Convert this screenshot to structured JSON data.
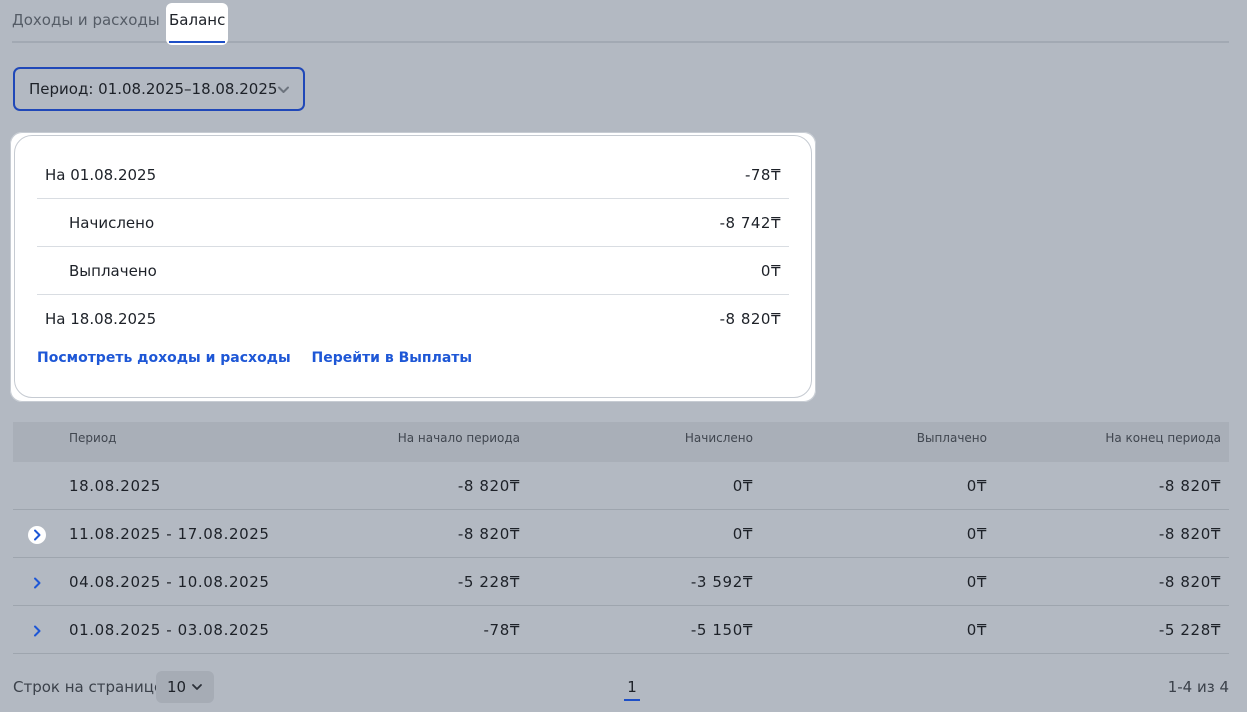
{
  "tabs": [
    {
      "label": "Доходы и расходы"
    },
    {
      "label": "Баланс"
    }
  ],
  "period_select": {
    "label": "Период: 01.08.2025–18.08.2025"
  },
  "balance_card": {
    "rows": [
      {
        "label": "На 01.08.2025",
        "value": "-78₸"
      },
      {
        "label": "Начислено",
        "value": "-8 742₸"
      },
      {
        "label": "Выплачено",
        "value": "0₸"
      },
      {
        "label": "На 18.08.2025",
        "value": "-8 820₸"
      }
    ],
    "links": {
      "view": "Посмотреть доходы и расходы",
      "payouts": "Перейти в Выплаты"
    }
  },
  "table": {
    "headers": {
      "period": "Период",
      "start": "На начало периода",
      "accrued": "Начислено",
      "paid": "Выплачено",
      "end": "На конец периода"
    },
    "rows": [
      {
        "period": "18.08.2025",
        "start": "-8 820₸",
        "accrued": "0₸",
        "paid": "0₸",
        "end": "-8 820₸"
      },
      {
        "period": "11.08.2025 - 17.08.2025",
        "start": "-8 820₸",
        "accrued": "0₸",
        "paid": "0₸",
        "end": "-8 820₸"
      },
      {
        "period": "04.08.2025 - 10.08.2025",
        "start": "-5 228₸",
        "accrued": "-3 592₸",
        "paid": "0₸",
        "end": "-8 820₸"
      },
      {
        "period": "01.08.2025 - 03.08.2025",
        "start": "-78₸",
        "accrued": "-5 150₸",
        "paid": "0₸",
        "end": "-5 228₸"
      }
    ]
  },
  "footer": {
    "rows_label": "Строк на странице:",
    "rows_value": "10",
    "page": "1",
    "range": "1-4 из 4"
  },
  "colors": {
    "accent": "#1e57d6",
    "background": "#b3b9c2"
  }
}
